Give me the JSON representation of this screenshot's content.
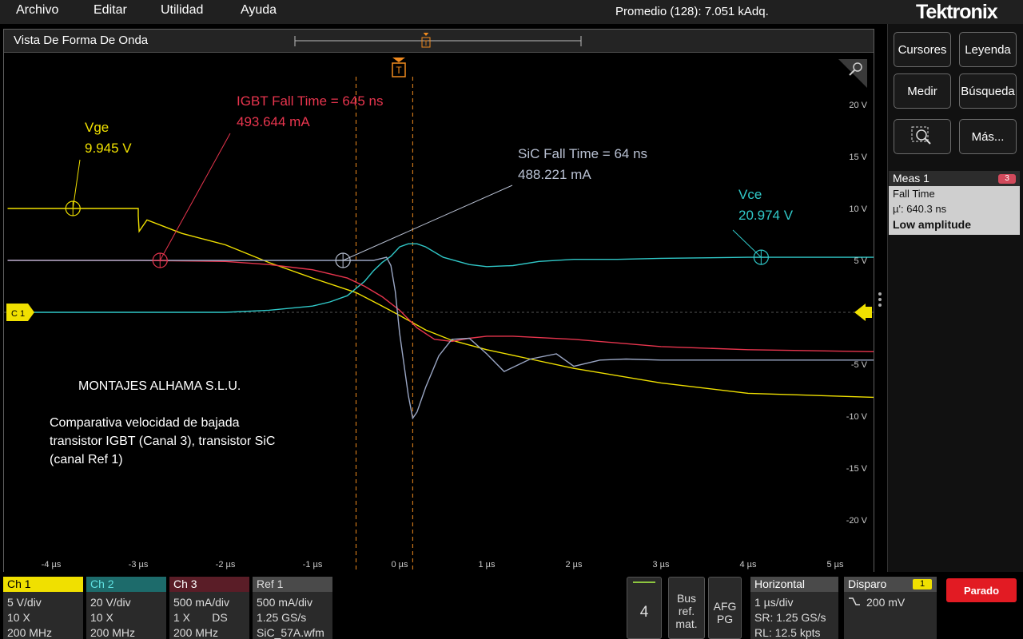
{
  "menu": {
    "archivo": "Archivo",
    "editar": "Editar",
    "utilidad": "Utilidad",
    "ayuda": "Ayuda"
  },
  "acquisition_status": "Promedio (128): 7.051 kAdq.",
  "brand": "Tektronix",
  "waveform_view": {
    "title": "Vista De Forma De Onda",
    "trigger_marker": "T",
    "channel_marker": "C 1"
  },
  "chart_data": {
    "type": "line",
    "x_range": [
      -4.5,
      5.5
    ],
    "y_range": [
      -25,
      25
    ],
    "x_ticks": [
      "-4 µs",
      "-3 µs",
      "-2 µs",
      "-1 µs",
      "0 µs",
      "1 µs",
      "2 µs",
      "3 µs",
      "4 µs",
      "5 µs"
    ],
    "x_tick_values": [
      -4,
      -3,
      -2,
      -1,
      0,
      1,
      2,
      3,
      4,
      5
    ],
    "y_ticks": [
      "20 V",
      "15 V",
      "10 V",
      "5 V",
      "0 V",
      "-5 V",
      "-10 V",
      "-15 V",
      "-20 V"
    ],
    "y_tick_values": [
      20,
      15,
      10,
      5,
      0,
      -5,
      -10,
      -15,
      -20
    ],
    "cursor_lines_us": [
      -0.5,
      0.15
    ],
    "series": [
      {
        "name": "Vge",
        "color": "#f0e000",
        "x": [
          -4.5,
          -3.0,
          -3.0,
          -2.99,
          -2.9,
          -2.5,
          -2.0,
          -1.5,
          -1.0,
          -0.5,
          -0.2,
          0.0,
          0.3,
          0.6,
          1.0,
          1.5,
          2.0,
          3.0,
          4.0,
          5.5
        ],
        "y": [
          10,
          10,
          9.3,
          7.8,
          8.9,
          7.6,
          6.5,
          4.8,
          3.3,
          1.9,
          0.6,
          -0.3,
          -1.7,
          -2.7,
          -3.6,
          -4.5,
          -5.4,
          -6.8,
          -7.8,
          -8.2
        ]
      },
      {
        "name": "Vce",
        "color": "#30c8c8",
        "x": [
          -4.5,
          -3.0,
          -2.0,
          -1.5,
          -1.0,
          -0.8,
          -0.6,
          -0.4,
          -0.3,
          -0.2,
          -0.1,
          0.0,
          0.1,
          0.2,
          0.3,
          0.5,
          0.8,
          1.0,
          1.3,
          1.6,
          2.0,
          2.5,
          3.0,
          4.0,
          5.5
        ],
        "y": [
          0,
          0,
          0,
          0.2,
          0.6,
          1.0,
          1.6,
          3.0,
          4.0,
          4.8,
          5.4,
          6.3,
          6.6,
          6.6,
          6.3,
          5.3,
          4.6,
          4.4,
          4.5,
          4.9,
          5.1,
          5.1,
          5.2,
          5.3,
          5.3
        ]
      },
      {
        "name": "IGBT Ch3",
        "color": "#e8354e",
        "x": [
          -4.5,
          -3.0,
          -2.0,
          -1.5,
          -1.0,
          -0.6,
          -0.4,
          -0.2,
          0.0,
          0.2,
          0.4,
          0.6,
          0.8,
          1.0,
          1.3,
          2.0,
          3.0,
          4.0,
          5.5
        ],
        "y": [
          5,
          5,
          4.9,
          4.6,
          4.1,
          3.3,
          2.5,
          1.5,
          0.2,
          -1.5,
          -2.6,
          -2.8,
          -2.5,
          -2.3,
          -2.3,
          -2.6,
          -3.3,
          -3.6,
          -3.8
        ]
      },
      {
        "name": "SiC Ref 1",
        "color": "#9aa6c4",
        "x": [
          -4.5,
          -1.0,
          -0.3,
          -0.15,
          -0.1,
          -0.05,
          0.0,
          0.1,
          0.15,
          0.2,
          0.3,
          0.45,
          0.6,
          0.8,
          1.0,
          1.2,
          1.5,
          1.8,
          2.0,
          2.3,
          2.6,
          3.0,
          4.0,
          5.5
        ],
        "y": [
          5,
          5,
          5,
          5.3,
          4.5,
          2.0,
          -2.0,
          -8.0,
          -10.2,
          -9.6,
          -7.2,
          -4.2,
          -2.6,
          -2.5,
          -4.0,
          -5.7,
          -4.5,
          -4.0,
          -5.2,
          -4.6,
          -4.5,
          -4.6,
          -4.6,
          -4.6
        ]
      }
    ],
    "annotations": [
      {
        "line1": "Vge",
        "line2": "9.945 V",
        "color": "#f0e000"
      },
      {
        "line1": "IGBT Fall Time = 645 ns",
        "line2": "493.644 mA",
        "color": "#e8354e"
      },
      {
        "line1": "SiC Fall Time = 64 ns",
        "line2": "488.221 mA",
        "color": "#b8c0d2"
      },
      {
        "line1": "Vce",
        "line2": "20.974 V",
        "color": "#30c8c8"
      }
    ]
  },
  "notes": {
    "company": "MONTAJES ALHAMA S.L.U.",
    "line1": "Comparativa velocidad de bajada",
    "line2": "transistor IGBT (Canal 3), transistor SiC",
    "line3": "(canal Ref 1)"
  },
  "right_panel": {
    "cursores": "Cursores",
    "leyenda": "Leyenda",
    "medir": "Medir",
    "busqueda": "Búsqueda",
    "mas": "Más..."
  },
  "measurement": {
    "title": "Meas 1",
    "count": "3",
    "type": "Fall Time",
    "mean": "µ': 640.3 ns",
    "status": "Low amplitude"
  },
  "channels": [
    {
      "name": "Ch 1",
      "color": "#f0e000",
      "text_color": "#000",
      "lines": [
        "5 V/div",
        "10 X",
        "200 MHz"
      ]
    },
    {
      "name": "Ch 2",
      "color": "#1d6b6b",
      "text_color": "#5fe0e0",
      "lines": [
        "20 V/div",
        "10 X",
        "200 MHz"
      ]
    },
    {
      "name": "Ch 3",
      "color": "#5a1d27",
      "text_color": "#ffffff",
      "lines": [
        "500 mA/div",
        "1 X       DS",
        "200 MHz"
      ]
    },
    {
      "name": "Ref 1",
      "color": "#4a4a4a",
      "text_color": "#dddddd",
      "lines": [
        "500 mA/div",
        "1.25 GS/s",
        "SiC_57A.wfm"
      ]
    }
  ],
  "math_button": "4",
  "bus_button": [
    "Bus",
    "ref.",
    "mat."
  ],
  "afg_button": [
    "AFG",
    "PG"
  ],
  "horizontal": {
    "title": "Horizontal",
    "lines": [
      "1 µs/div",
      "SR: 1.25 GS/s",
      "RL: 12.5 kpts"
    ]
  },
  "trigger": {
    "title": "Disparo",
    "badge": "1",
    "level": "200 mV"
  },
  "run_state": "Parado"
}
